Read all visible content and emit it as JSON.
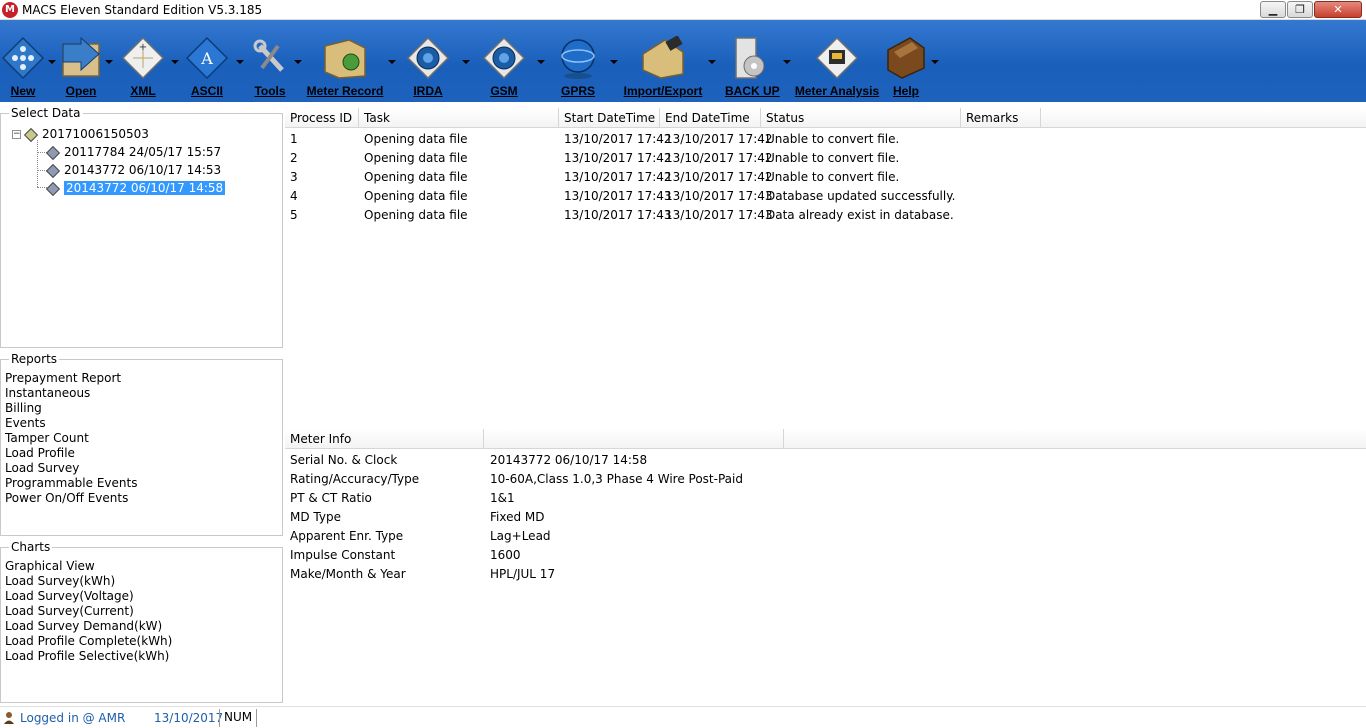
{
  "window": {
    "title": "MACS Eleven Standard Edition V5.3.185",
    "app_icon_letter": "M",
    "minimize_glyph": "▁",
    "maximize_glyph": "❐",
    "close_glyph": "✕"
  },
  "toolbar": {
    "items": [
      {
        "label": "New",
        "icon": "new-icon"
      },
      {
        "label": "Open",
        "icon": "open-folder-icon"
      },
      {
        "label": "XML",
        "icon": "xml-icon"
      },
      {
        "label": "ASCII",
        "icon": "ascii-icon"
      },
      {
        "label": "Tools",
        "icon": "tools-icon"
      },
      {
        "label": "Meter Record",
        "icon": "meter-record-icon"
      },
      {
        "label": "IRDA",
        "icon": "irda-icon"
      },
      {
        "label": "GSM",
        "icon": "gsm-icon"
      },
      {
        "label": "GPRS",
        "icon": "gprs-icon"
      },
      {
        "label": "Import/Export",
        "icon": "import-export-icon"
      },
      {
        "label": "BACK UP",
        "icon": "backup-icon"
      },
      {
        "label": "Meter Analysis",
        "icon": "meter-analysis-icon"
      },
      {
        "label": "Help",
        "icon": "help-book-icon"
      }
    ],
    "colors": {
      "background": "#1d62bd"
    }
  },
  "select_data": {
    "title": "Select Data",
    "root": "20171006150503",
    "toggle_glyph": "−",
    "children": [
      "20117784 24/05/17 15:57",
      "20143772 06/10/17 14:53",
      "20143772 06/10/17 14:58"
    ],
    "selected_index": 2
  },
  "reports": {
    "title": "Reports",
    "items": [
      "Prepayment Report",
      "Instantaneous",
      "Billing",
      "Events",
      "Tamper Count",
      "Load Profile",
      "Load Survey",
      "Programmable Events",
      "Power On/Off Events"
    ]
  },
  "charts": {
    "title": "Charts",
    "items": [
      "Graphical View",
      "Load Survey(kWh)",
      "Load Survey(Voltage)",
      "Load Survey(Current)",
      "Load Survey Demand(kW)",
      "Load Profile Complete(kWh)",
      "Load Profile Selective(kWh)"
    ]
  },
  "process_grid": {
    "columns": [
      "Process ID",
      "Task",
      "Start DateTime",
      "End DateTime",
      "Status",
      "Remarks"
    ],
    "rows": [
      [
        "1",
        "Opening data file",
        "13/10/2017 17:42",
        "13/10/2017 17:42",
        "Unable to convert file.",
        ""
      ],
      [
        "2",
        "Opening data file",
        "13/10/2017 17:42",
        "13/10/2017 17:42",
        "Unable to convert file.",
        ""
      ],
      [
        "3",
        "Opening data file",
        "13/10/2017 17:42",
        "13/10/2017 17:42",
        "Unable to convert file.",
        ""
      ],
      [
        "4",
        "Opening data file",
        "13/10/2017 17:43",
        "13/10/2017 17:43",
        "Database updated successfully.",
        ""
      ],
      [
        "5",
        "Opening data file",
        "13/10/2017 17:43",
        "13/10/2017 17:43",
        "Data already exist in database.",
        ""
      ]
    ]
  },
  "meter_info": {
    "title": "Meter Info",
    "rows": [
      [
        "Serial No. & Clock",
        "20143772 06/10/17 14:58"
      ],
      [
        "Rating/Accuracy/Type",
        "10-60A,Class 1.0,3 Phase 4 Wire Post-Paid"
      ],
      [
        "PT & CT Ratio",
        "1&1"
      ],
      [
        "MD Type",
        "Fixed MD"
      ],
      [
        "Apparent Enr. Type",
        "Lag+Lead"
      ],
      [
        "Impulse Constant",
        "1600"
      ],
      [
        "Make/Month & Year",
        "HPL/JUL 17"
      ]
    ]
  },
  "statusbar": {
    "logged_in": "Logged in @ AMR",
    "date": "13/10/2017",
    "num": "NUM"
  }
}
